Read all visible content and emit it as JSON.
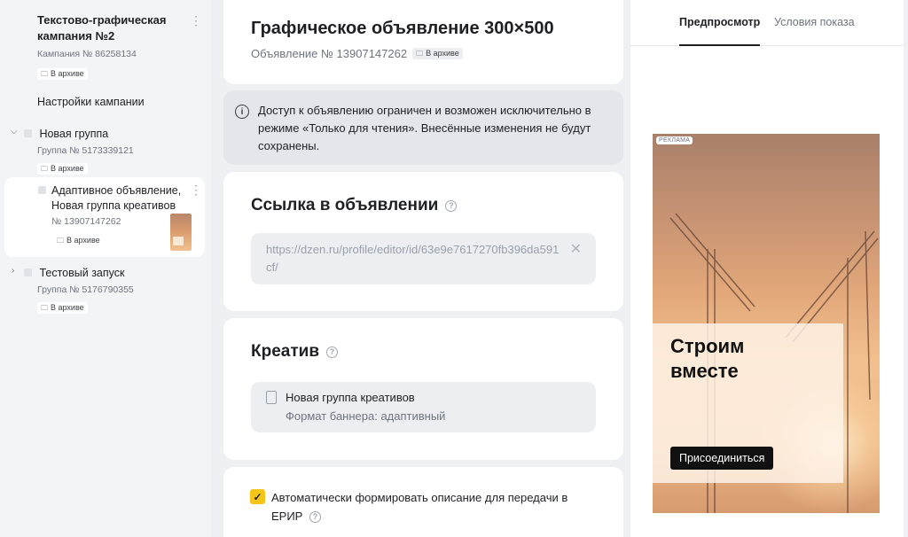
{
  "sidebar": {
    "campaign": {
      "title": "Текстово-графическая кампания №2",
      "number": "Кампания № 86258134",
      "badge": "В архиве"
    },
    "settings_link": "Настройки кампании",
    "group1": {
      "title": "Новая группа",
      "number": "Группа № 5173339121",
      "badge": "В архиве"
    },
    "ad_item": {
      "title": "Адаптивное объявление, Новая группа креативов",
      "number": "№ 13907147262",
      "badge": "В архиве"
    },
    "group2": {
      "title": "Тестовый запуск",
      "number": "Группа № 5176790355",
      "badge": "В архиве"
    }
  },
  "header": {
    "title": "Графическое объявление 300×500",
    "ad_number": "Объявление № 13907147262",
    "badge": "В архиве"
  },
  "notice": {
    "text": "Доступ к объявлению ограничен и возможен исключительно в режиме «Только для чтения». Внесённые изменения не будут сохранены."
  },
  "link_section": {
    "title": "Ссылка в объявлении",
    "url": "https://dzen.ru/profile/editor/id/63e9e7617270fb396da591cf/"
  },
  "creative_section": {
    "title": "Креатив",
    "name": "Новая группа креативов",
    "format": "Формат баннера: адаптивный"
  },
  "erir": {
    "label": "Автоматически формировать описание для передачи в ЕРИР",
    "checked": true
  },
  "preview": {
    "tabs": [
      "Предпросмотр",
      "Условия показа"
    ],
    "ad_label": "РЕКЛАМА",
    "headline": "Строим вместе",
    "cta": "Присоединиться"
  },
  "colors": {
    "accent_checkbox": "#f5c518",
    "cta_background": "#111111"
  }
}
